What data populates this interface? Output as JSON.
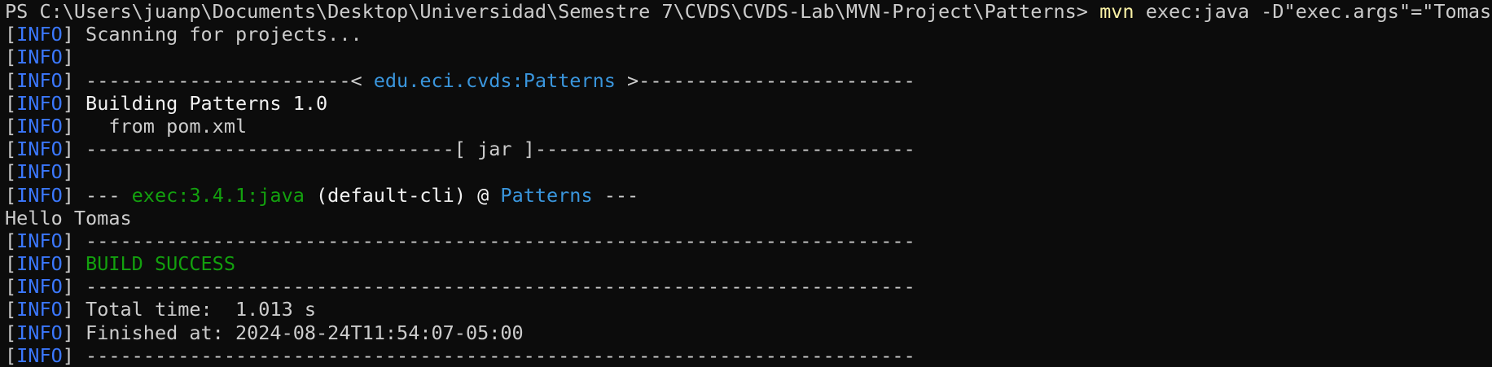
{
  "prompt": {
    "ps_prefix": "PS ",
    "path": "C:\\Users\\juanp\\Documents\\Desktop\\Universidad\\Semestre 7\\CVDS\\CVDS-Lab\\MVN-Project\\Patterns> ",
    "command": "mvn",
    "args": " exec:java -D\"exec.args\"=\"Tomas\""
  },
  "tag": {
    "open": "[",
    "label": "INFO",
    "close": "]"
  },
  "lines": {
    "l1": " Scanning for projects...",
    "l2": "",
    "l3_left": " -----------------------< ",
    "l3_artifact": "edu.eci.cvds:Patterns",
    "l3_right": " >------------------------",
    "l4": " Building Patterns 1.0",
    "l5": "   from pom.xml",
    "l6": " --------------------------------[ jar ]---------------------------------",
    "l7": "",
    "l8_dash1": " --- ",
    "l8_plugin": "exec:3.4.1:java",
    "l8_mid": " (default-cli) @ ",
    "l8_project": "Patterns",
    "l8_dash2": " ---",
    "hello": "Hello Tomas",
    "sep": " ------------------------------------------------------------------------",
    "build": " BUILD SUCCESS",
    "total_time": " Total time:  1.013 s",
    "finished_at": " Finished at: 2024-08-24T11:54:07-05:00"
  },
  "colors": {
    "background": "#0c0c0c",
    "text": "#cccccc",
    "info_tag": "#3b78ff",
    "artifact": "#3a96dd",
    "success": "#13a10e",
    "command": "#f9f1a5"
  }
}
